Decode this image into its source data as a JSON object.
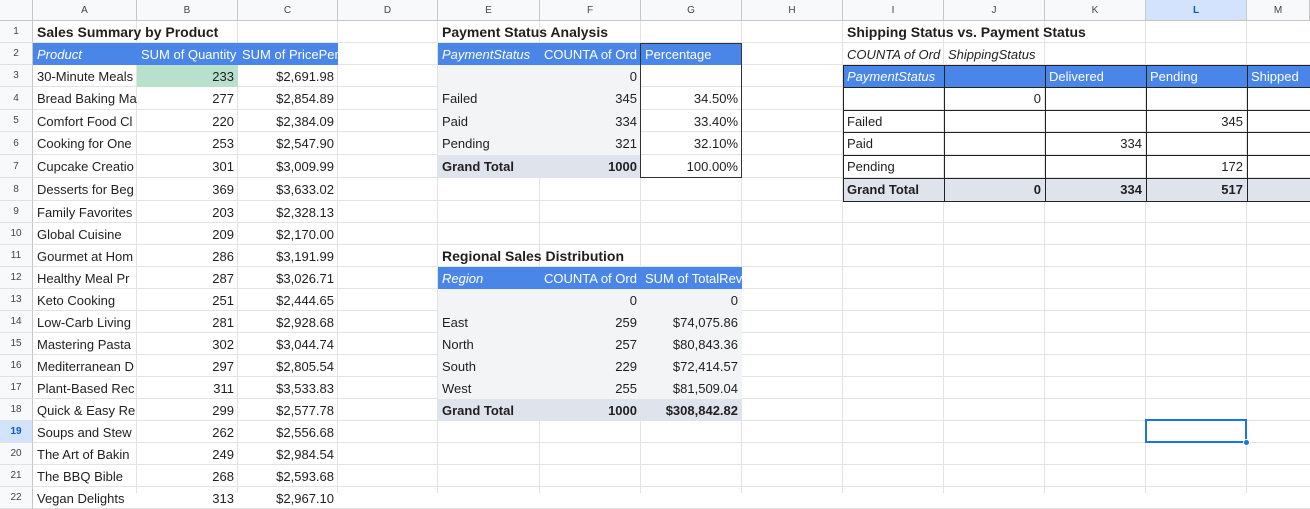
{
  "columns": [
    "A",
    "B",
    "C",
    "D",
    "E",
    "F",
    "G",
    "H",
    "I",
    "J",
    "K",
    "L",
    "M"
  ],
  "rows": [
    "1",
    "2",
    "3",
    "4",
    "5",
    "6",
    "7",
    "8",
    "9",
    "10",
    "11",
    "12",
    "13",
    "14",
    "15",
    "16",
    "17",
    "18",
    "19",
    "20",
    "21",
    "22"
  ],
  "sales": {
    "title": "Sales Summary by Product",
    "headers": [
      "Product",
      "SUM of Quantity",
      "SUM of PricePer"
    ],
    "rows": [
      [
        "30-Minute Meals",
        "233",
        "$2,691.98"
      ],
      [
        "Bread Baking Ma",
        "277",
        "$2,854.89"
      ],
      [
        "Comfort Food Cl",
        "220",
        "$2,384.09"
      ],
      [
        "Cooking for One",
        "253",
        "$2,547.90"
      ],
      [
        "Cupcake Creatio",
        "301",
        "$3,009.99"
      ],
      [
        "Desserts for Beg",
        "369",
        "$3,633.02"
      ],
      [
        "Family Favorites",
        "203",
        "$2,328.13"
      ],
      [
        "Global Cuisine",
        "209",
        "$2,170.00"
      ],
      [
        "Gourmet at Hom",
        "286",
        "$3,191.99"
      ],
      [
        "Healthy Meal Pr",
        "287",
        "$3,026.71"
      ],
      [
        "Keto Cooking",
        "251",
        "$2,444.65"
      ],
      [
        "Low-Carb Living",
        "281",
        "$2,928.68"
      ],
      [
        "Mastering Pasta",
        "302",
        "$3,044.74"
      ],
      [
        "Mediterranean D",
        "297",
        "$2,805.54"
      ],
      [
        "Plant-Based Rec",
        "311",
        "$3,533.83"
      ],
      [
        "Quick & Easy Re",
        "299",
        "$2,577.78"
      ],
      [
        "Soups and Stew",
        "262",
        "$2,556.68"
      ],
      [
        "The Art of Bakin",
        "249",
        "$2,984.54"
      ],
      [
        "The BBQ Bible",
        "268",
        "$2,593.68"
      ],
      [
        "Vegan Delights",
        "313",
        "$2,967.10"
      ]
    ]
  },
  "payment": {
    "title": "Payment Status Analysis",
    "headers": [
      "PaymentStatus",
      "COUNTA of Ord",
      "Percentage"
    ],
    "rows": [
      [
        "",
        "0",
        ""
      ],
      [
        "Failed",
        "345",
        "34.50%"
      ],
      [
        "Paid",
        "334",
        "33.40%"
      ],
      [
        "Pending",
        "321",
        "32.10%"
      ]
    ],
    "total": [
      "Grand Total",
      "1000",
      "100.00%"
    ]
  },
  "region": {
    "title": "Regional Sales Distribution",
    "headers": [
      "Region",
      "COUNTA of Ord",
      "SUM of TotalRev"
    ],
    "rows": [
      [
        "",
        "0",
        "0"
      ],
      [
        "East",
        "259",
        "$74,075.86"
      ],
      [
        "North",
        "257",
        "$80,843.36"
      ],
      [
        "South",
        "229",
        "$72,414.57"
      ],
      [
        "West",
        "255",
        "$81,509.04"
      ]
    ],
    "total": [
      "Grand Total",
      "1000",
      "$308,842.82"
    ]
  },
  "shipping": {
    "title": "Shipping Status vs. Payment Status",
    "row2": [
      "COUNTA of Ord",
      "ShippingStatus"
    ],
    "headers": [
      "PaymentStatus",
      "",
      "Delivered",
      "Pending",
      "Shipped"
    ],
    "rows": [
      [
        "",
        "0",
        "",
        "",
        ""
      ],
      [
        "Failed",
        "",
        "",
        "345",
        ""
      ],
      [
        "Paid",
        "",
        "334",
        "",
        ""
      ],
      [
        "Pending",
        "",
        "",
        "172",
        ""
      ]
    ],
    "total": [
      "Grand Total",
      "0",
      "334",
      "517",
      ""
    ]
  },
  "colors": {
    "pivot_header": "#4a86e8",
    "grand_total_bg": "#dfe3eb",
    "highlight": "#b7e1cd",
    "selection": "#1a73e8"
  }
}
